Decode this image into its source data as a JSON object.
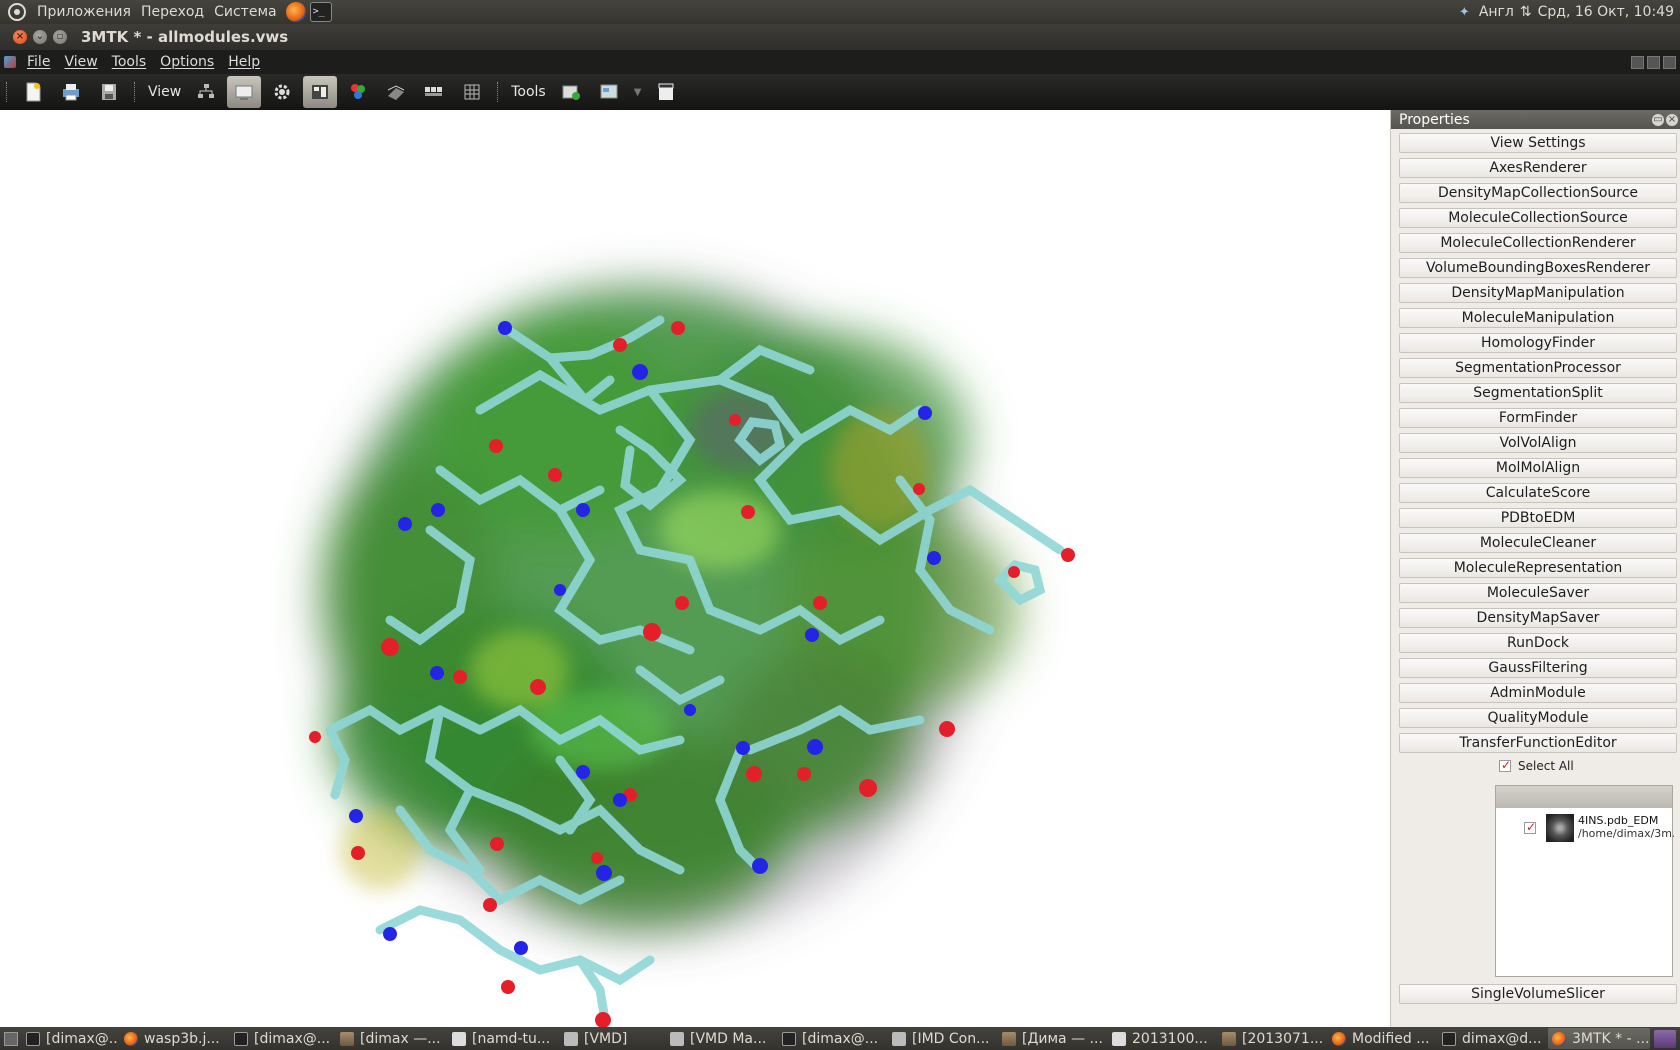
{
  "top_panel": {
    "menus": [
      "Приложения",
      "Переход",
      "Система"
    ],
    "keyboard_layout": "Англ",
    "clock": "Срд, 16 Окт, 10:49"
  },
  "window": {
    "title": "3MTK * - allmodules.vws"
  },
  "menubar": {
    "items": [
      "File",
      "View",
      "Tools",
      "Options",
      "Help"
    ]
  },
  "toolbar": {
    "view_label": "View",
    "tools_label": "Tools"
  },
  "properties": {
    "title": "Properties",
    "modules": [
      "View Settings",
      "AxesRenderer",
      "DensityMapCollectionSource",
      "MoleculeCollectionSource",
      "MoleculeCollectionRenderer",
      "VolumeBoundingBoxesRenderer",
      "DensityMapManipulation",
      "MoleculeManipulation",
      "HomologyFinder",
      "SegmentationProcessor",
      "SegmentationSplit",
      "FormFinder",
      "VolVolAlign",
      "MolMolAlign",
      "CalculateScore",
      "PDBtoEDM",
      "MoleculeCleaner",
      "MoleculeRepresentation",
      "MoleculeSaver",
      "DensityMapSaver",
      "RunDock",
      "GaussFiltering",
      "AdminModule",
      "QualityModule",
      "TransferFunctionEditor"
    ],
    "select_all_label": "Select All",
    "dataset": {
      "name": "4INS.pdb_EDM",
      "path": "/home/dimax/3m..."
    },
    "last_module": "SingleVolumeSlicer"
  },
  "taskbar": {
    "tasks": [
      {
        "label": "[dimax@...",
        "icon": "terminal-icon"
      },
      {
        "label": "wasp3b.j...",
        "icon": "firefox-icon"
      },
      {
        "label": "[dimax@...",
        "icon": "terminal-icon"
      },
      {
        "label": "[dimax —...",
        "icon": "folder-icon"
      },
      {
        "label": "[namd-tu...",
        "icon": "document-icon"
      },
      {
        "label": "[VMD]",
        "icon": "window-icon"
      },
      {
        "label": "[VMD Ma...",
        "icon": "window-icon"
      },
      {
        "label": "[dimax@...",
        "icon": "terminal-icon"
      },
      {
        "label": "[IMD Con...",
        "icon": "window-icon"
      },
      {
        "label": "[Дима — ...",
        "icon": "folder-icon"
      },
      {
        "label": "2013100...",
        "icon": "document-icon"
      },
      {
        "label": "[2013071...",
        "icon": "folder-icon"
      },
      {
        "label": "Modified ...",
        "icon": "firefox-icon"
      },
      {
        "label": "dimax@d...",
        "icon": "terminal-icon"
      },
      {
        "label": "3MTK * - ...",
        "icon": "app-icon"
      }
    ]
  },
  "colors": {
    "carbon_bond": "#8fd6d6",
    "oxygen": "#e3202a",
    "nitrogen": "#2424e6",
    "density_green": "#2e9a2a",
    "density_yellow": "#b59a20",
    "accent": "#dd4814"
  }
}
